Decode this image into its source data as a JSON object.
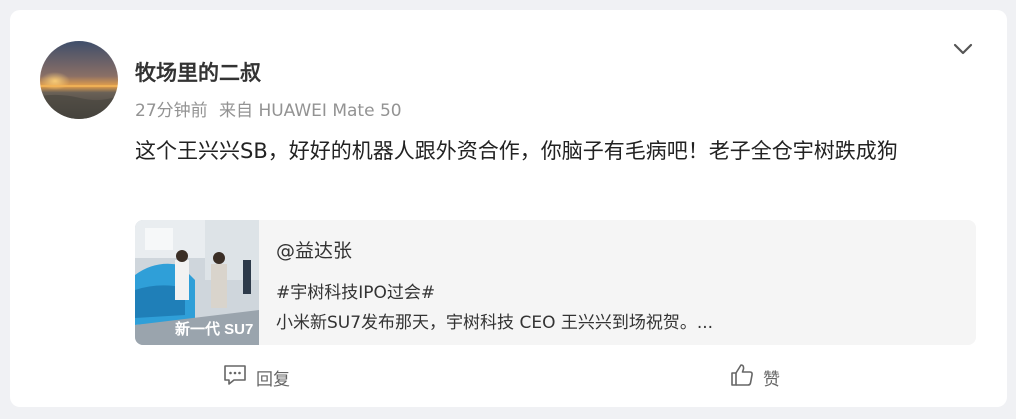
{
  "post": {
    "author": "牧场里的二叔",
    "time": "27分钟前",
    "source": "来自 HUAWEI Mate 50",
    "text": "这个王兴兴SB，好好的机器人跟外资合作，你脑子有毛病吧！老子全仓宇树跌成狗",
    "icons": {
      "avatar": "sunset-avatar",
      "more": "chevron-down-icon"
    }
  },
  "quote": {
    "author": "@益达张",
    "topic": "#宇树科技IPO过会#",
    "summary": "小米新SU7发布那天，宇树科技 CEO 王兴兴到场祝贺。...",
    "thumbnail_text": "新一代 SU7"
  },
  "actions": {
    "reply_label": "回复",
    "like_label": "赞"
  }
}
